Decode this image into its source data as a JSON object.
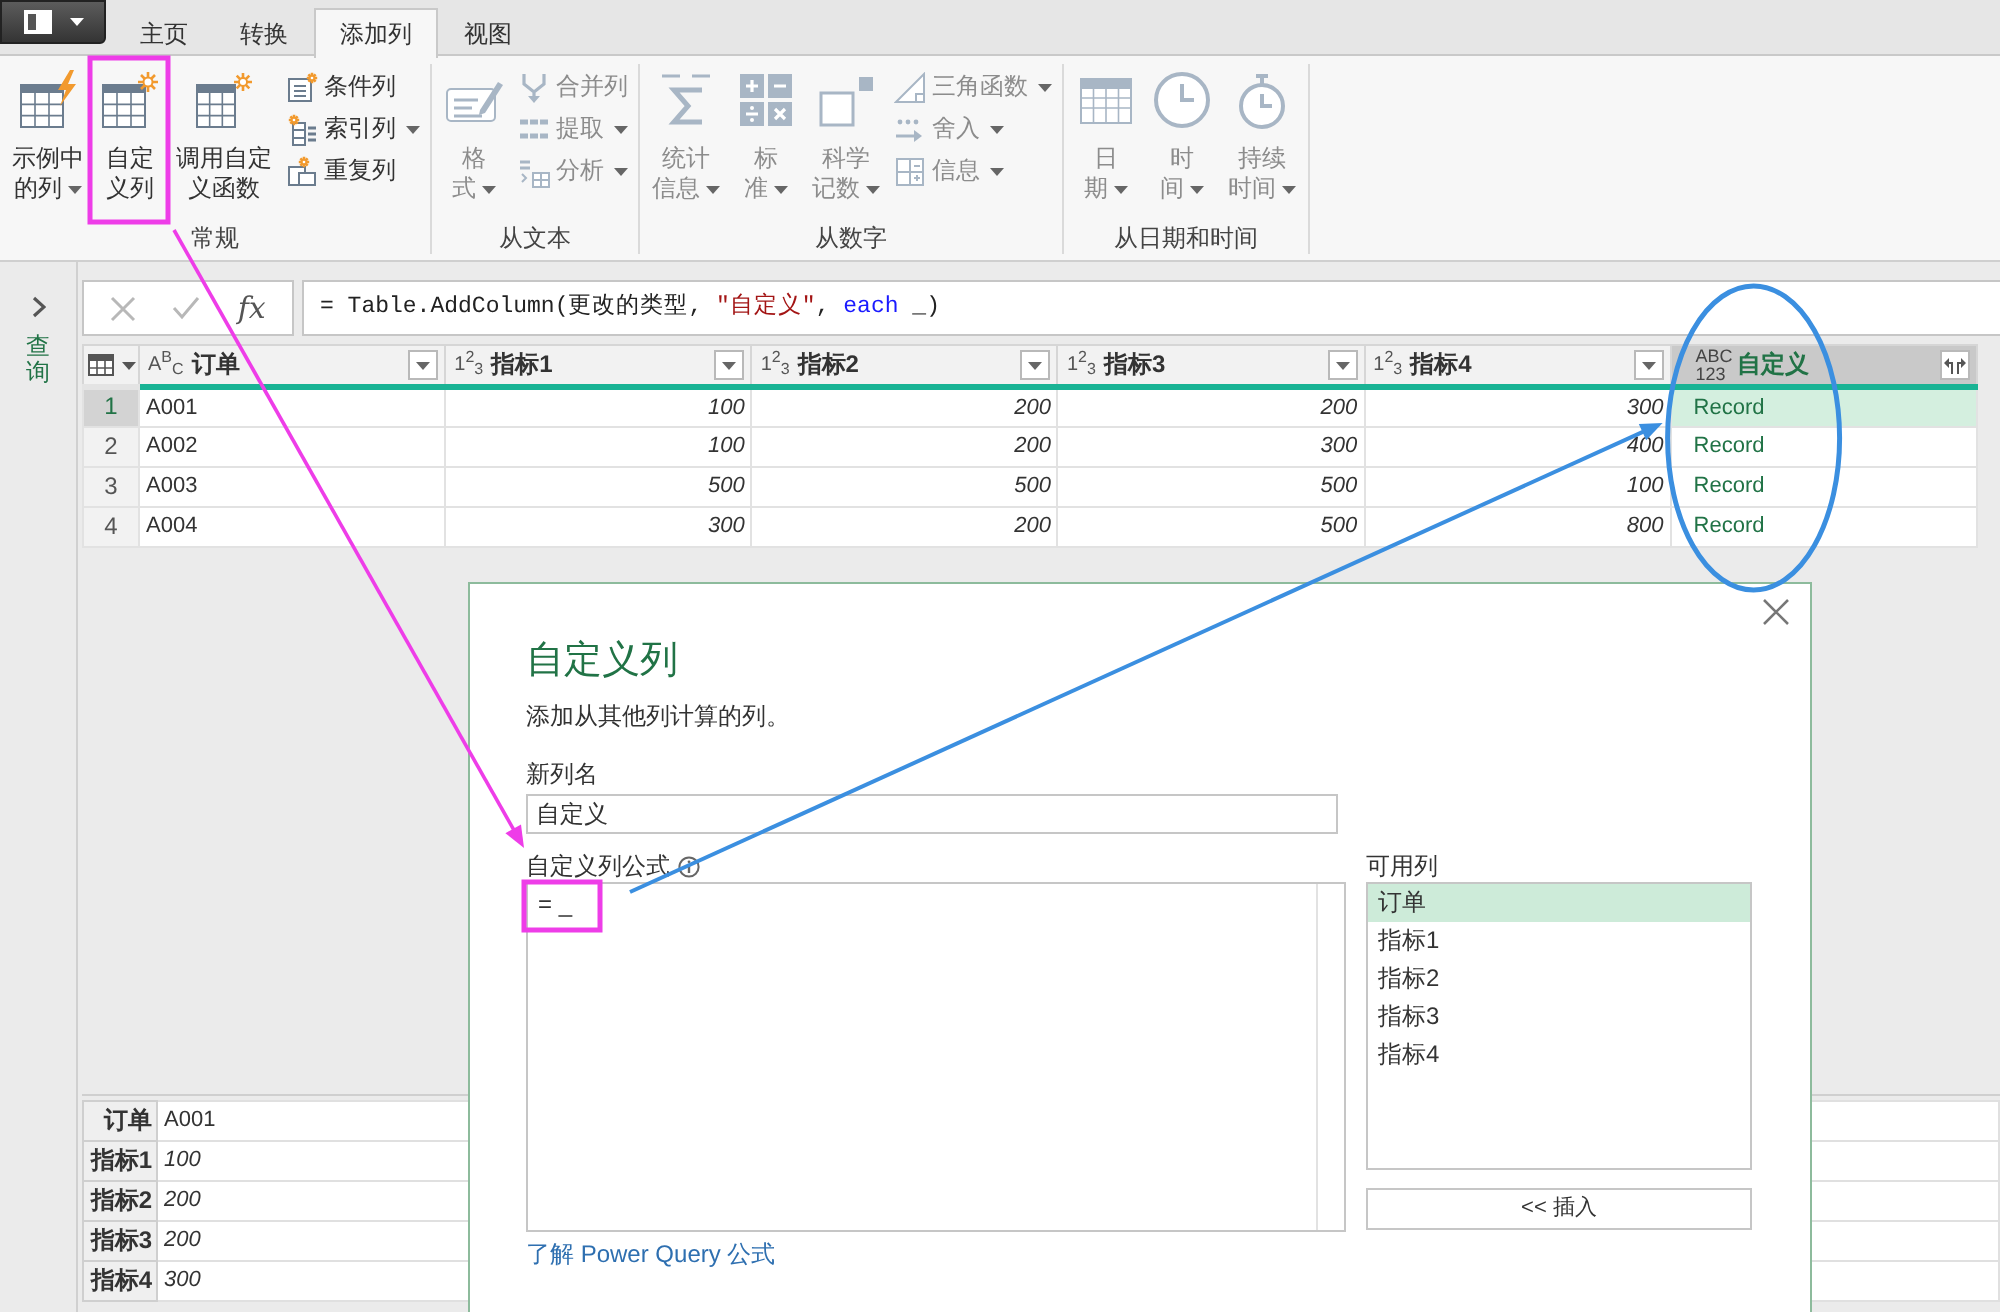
{
  "ribbon_tabs": [
    {
      "label": "主页",
      "selected": false
    },
    {
      "label": "转换",
      "selected": false
    },
    {
      "label": "添加列",
      "selected": true
    },
    {
      "label": "视图",
      "selected": false
    }
  ],
  "ribbon_groups": [
    {
      "label": "常规",
      "items": [
        {
          "kind": "large",
          "lines": [
            "示例中",
            "的列"
          ],
          "dropdown": true,
          "disabled": false
        },
        {
          "kind": "large",
          "lines": [
            "自定",
            "义列"
          ],
          "dropdown": false,
          "disabled": false
        },
        {
          "kind": "large",
          "lines": [
            "调用自定",
            "义函数"
          ],
          "dropdown": false,
          "disabled": false
        },
        {
          "kind": "stack",
          "items": [
            {
              "label": "条件列",
              "dropdown": false,
              "disabled": false
            },
            {
              "label": "索引列",
              "dropdown": true,
              "disabled": false
            },
            {
              "label": "重复列",
              "dropdown": false,
              "disabled": false
            }
          ]
        }
      ]
    },
    {
      "label": "从文本",
      "items": [
        {
          "kind": "large",
          "lines": [
            "格",
            "式"
          ],
          "dropdown": true,
          "disabled": true
        },
        {
          "kind": "stack",
          "items": [
            {
              "label": "合并列",
              "dropdown": false,
              "disabled": true
            },
            {
              "label": "提取",
              "dropdown": true,
              "disabled": true
            },
            {
              "label": "分析",
              "dropdown": true,
              "disabled": true
            }
          ]
        }
      ]
    },
    {
      "label": "从数字",
      "items": [
        {
          "kind": "large",
          "lines": [
            "统计",
            "信息"
          ],
          "dropdown": true,
          "disabled": true
        },
        {
          "kind": "large",
          "lines": [
            "标",
            "准"
          ],
          "dropdown": true,
          "disabled": true
        },
        {
          "kind": "large",
          "lines": [
            "科学",
            "记数"
          ],
          "dropdown": true,
          "disabled": true
        },
        {
          "kind": "stack",
          "items": [
            {
              "label": "三角函数",
              "dropdown": true,
              "disabled": true
            },
            {
              "label": "舍入",
              "dropdown": true,
              "disabled": true
            },
            {
              "label": "信息",
              "dropdown": true,
              "disabled": true
            }
          ]
        }
      ]
    },
    {
      "label": "从日期和时间",
      "items": [
        {
          "kind": "large",
          "lines": [
            "日",
            "期"
          ],
          "dropdown": true,
          "disabled": true
        },
        {
          "kind": "large",
          "lines": [
            "时",
            "间"
          ],
          "dropdown": true,
          "disabled": true
        },
        {
          "kind": "large",
          "lines": [
            "持续",
            "时间"
          ],
          "dropdown": true,
          "disabled": true
        }
      ]
    }
  ],
  "queries_pane": {
    "label": "查询"
  },
  "formula_bar": {
    "function_label": "fx",
    "formula": [
      {
        "kind": "plain",
        "text": "= Table.AddColumn(更改的类型, "
      },
      {
        "kind": "string",
        "text": "\"自定义\""
      },
      {
        "kind": "plain",
        "text": ", "
      },
      {
        "kind": "keyword",
        "text": "each"
      },
      {
        "kind": "plain",
        "text": " _)"
      }
    ]
  },
  "table": {
    "columns": [
      {
        "kind": "text",
        "type_label": [
          "A$^{B}$$_{C}$"
        ],
        "name": "订单",
        "selected": false
      },
      {
        "kind": "number",
        "type_label": [
          "1$^{2}$$_{3}$"
        ],
        "name": "指标1",
        "selected": false
      },
      {
        "kind": "number",
        "type_label": [
          "1$^{2}$$_{3}$"
        ],
        "name": "指标2",
        "selected": false
      },
      {
        "kind": "number",
        "type_label": [
          "1$^{2}$$_{3}$"
        ],
        "name": "指标3",
        "selected": false
      },
      {
        "kind": "number",
        "type_label": [
          "1$^{2}$$_{3}$"
        ],
        "name": "指标4",
        "selected": false
      },
      {
        "kind": "record",
        "type_label": [
          "ABC",
          "123"
        ],
        "name": "自定义",
        "selected": true
      }
    ],
    "rows": [
      {
        "number": "1",
        "selected": true,
        "cells": [
          "A001",
          "100",
          "200",
          "200",
          "300",
          "Record"
        ]
      },
      {
        "number": "2",
        "selected": false,
        "cells": [
          "A002",
          "100",
          "200",
          "300",
          "400",
          "Record"
        ]
      },
      {
        "number": "3",
        "selected": false,
        "cells": [
          "A003",
          "500",
          "500",
          "500",
          "100",
          "Record"
        ]
      },
      {
        "number": "4",
        "selected": false,
        "cells": [
          "A004",
          "300",
          "200",
          "500",
          "800",
          "Record"
        ]
      }
    ]
  },
  "details": [
    {
      "label": "订单",
      "value": "A001",
      "kind": "text"
    },
    {
      "label": "指标1",
      "value": "100",
      "kind": "number"
    },
    {
      "label": "指标2",
      "value": "200",
      "kind": "number"
    },
    {
      "label": "指标3",
      "value": "200",
      "kind": "number"
    },
    {
      "label": "指标4",
      "value": "300",
      "kind": "number"
    }
  ],
  "dialog": {
    "title": "自定义列",
    "description": "添加从其他列计算的列。",
    "name_label": "新列名",
    "name_value": "自定义",
    "formula_label": "自定义列公式",
    "formula_value": "= _",
    "columns_label": "可用列",
    "available_columns": [
      {
        "label": "订单",
        "selected": true
      },
      {
        "label": "指标1",
        "selected": false
      },
      {
        "label": "指标2",
        "selected": false
      },
      {
        "label": "指标3",
        "selected": false
      },
      {
        "label": "指标4",
        "selected": false
      }
    ],
    "insert_button": "<< 插入",
    "help_link": "了解 Power Query 公式"
  }
}
